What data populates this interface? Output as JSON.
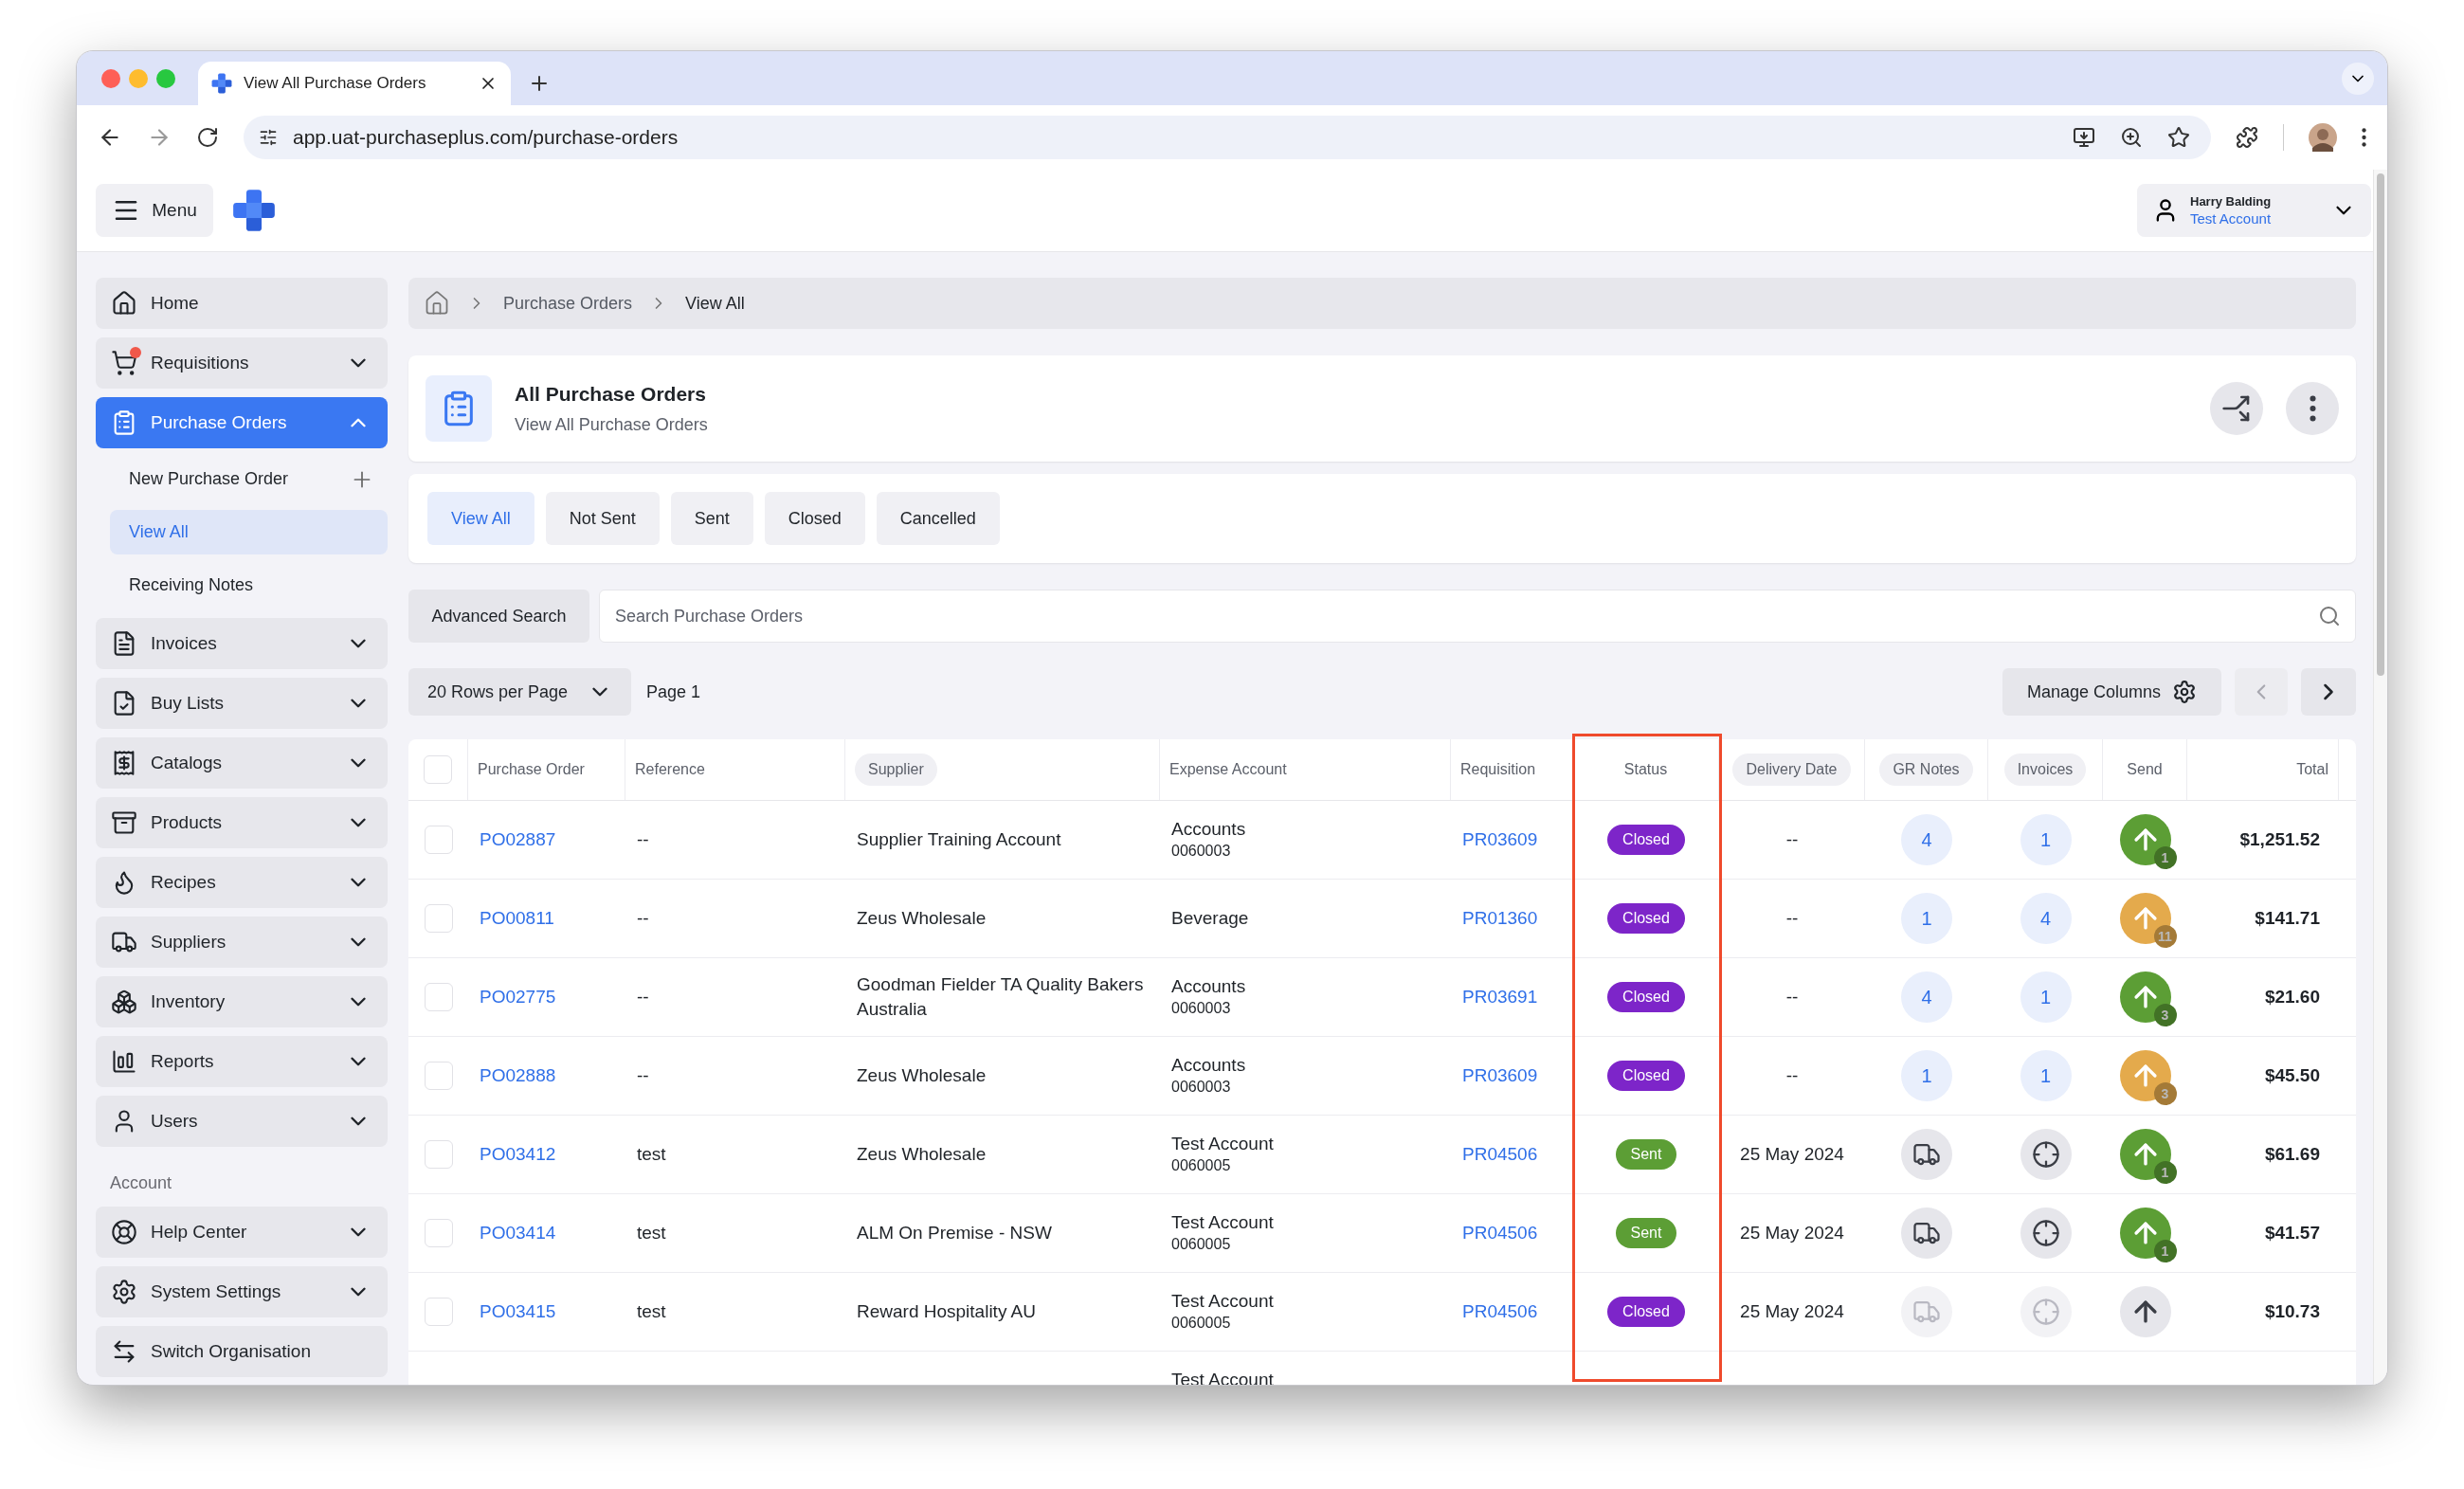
{
  "browser": {
    "tab_title": "View All Purchase Orders",
    "url": "app.uat-purchaseplus.com/purchase-orders"
  },
  "header": {
    "menu_label": "Menu",
    "user_name": "Harry Balding",
    "user_account": "Test Account"
  },
  "sidebar": {
    "items": [
      {
        "label": "Home",
        "kind": "link",
        "notification": false,
        "selected": false
      },
      {
        "label": "Requisitions",
        "kind": "group",
        "expanded": false,
        "notification": true,
        "selected": false
      },
      {
        "label": "Purchase Orders",
        "kind": "group",
        "expanded": true,
        "notification": false,
        "selected": true,
        "children": [
          {
            "label": "New Purchase Order",
            "kind": "action",
            "selected": false
          },
          {
            "label": "View All",
            "kind": "link",
            "selected": true
          },
          {
            "label": "Receiving Notes",
            "kind": "link",
            "selected": false
          }
        ]
      },
      {
        "label": "Invoices",
        "kind": "group",
        "expanded": false,
        "notification": false,
        "selected": false
      },
      {
        "label": "Buy Lists",
        "kind": "group",
        "expanded": false,
        "notification": false,
        "selected": false
      },
      {
        "label": "Catalogs",
        "kind": "group",
        "expanded": false,
        "notification": false,
        "selected": false
      },
      {
        "label": "Products",
        "kind": "group",
        "expanded": false,
        "notification": false,
        "selected": false
      },
      {
        "label": "Recipes",
        "kind": "group",
        "expanded": false,
        "notification": false,
        "selected": false
      },
      {
        "label": "Suppliers",
        "kind": "group",
        "expanded": false,
        "notification": false,
        "selected": false
      },
      {
        "label": "Inventory",
        "kind": "group",
        "expanded": false,
        "notification": false,
        "selected": false
      },
      {
        "label": "Reports",
        "kind": "group",
        "expanded": false,
        "notification": false,
        "selected": false
      },
      {
        "label": "Users",
        "kind": "group",
        "expanded": false,
        "notification": false,
        "selected": false
      }
    ],
    "section_label": "Account",
    "account_items": [
      {
        "label": "Help Center",
        "kind": "group",
        "expanded": false
      },
      {
        "label": "System Settings",
        "kind": "group",
        "expanded": false
      },
      {
        "label": "Switch Organisation",
        "kind": "link"
      }
    ]
  },
  "breadcrumb": [
    "Purchase Orders",
    "View All"
  ],
  "page": {
    "title": "All Purchase Orders",
    "subtitle": "View All Purchase Orders"
  },
  "filter_tabs": [
    {
      "label": "View All",
      "selected": true
    },
    {
      "label": "Not Sent",
      "selected": false
    },
    {
      "label": "Sent",
      "selected": false
    },
    {
      "label": "Closed",
      "selected": false
    },
    {
      "label": "Cancelled",
      "selected": false
    }
  ],
  "search": {
    "button": "Advanced Search",
    "placeholder": "Search Purchase Orders"
  },
  "pager": {
    "rows_per_page": "20 Rows per Page",
    "page": "Page 1",
    "manage_columns": "Manage Columns",
    "prev_disabled": true,
    "next_disabled": false
  },
  "table": {
    "select_all": {
      "checked": false
    },
    "columns": [
      {
        "label": "Purchase Order",
        "sortable": false,
        "highlighted": false
      },
      {
        "label": "Reference",
        "sortable": false,
        "highlighted": false
      },
      {
        "label": "Supplier",
        "sortable": true,
        "highlighted": false
      },
      {
        "label": "Expense Account",
        "sortable": false,
        "highlighted": false
      },
      {
        "label": "Requisition",
        "sortable": false,
        "highlighted": false
      },
      {
        "label": "Status",
        "sortable": false,
        "highlighted": true
      },
      {
        "label": "Delivery Date",
        "sortable": true,
        "highlighted": false
      },
      {
        "label": "GR Notes",
        "sortable": true,
        "highlighted": false
      },
      {
        "label": "Invoices",
        "sortable": true,
        "highlighted": false
      },
      {
        "label": "Send",
        "sortable": false,
        "highlighted": false
      },
      {
        "label": "Total",
        "sortable": false,
        "highlighted": false
      }
    ],
    "rows": [
      {
        "kind": "full",
        "checked": false,
        "purchase_order": "PO02887",
        "reference": "--",
        "supplier": "Supplier Training Account",
        "expense_account": "Accounts",
        "expense_code": "0060003",
        "requisition": "PR03609",
        "status": {
          "text": "Closed",
          "kind": "closed"
        },
        "delivery_date": "--",
        "gr_notes": {
          "kind": "count",
          "text": "4"
        },
        "invoices": {
          "kind": "count",
          "text": "1"
        },
        "send": {
          "color": "#5c9e35",
          "active": true,
          "count": "1"
        },
        "total": "$1,251.52"
      },
      {
        "kind": "full",
        "checked": false,
        "purchase_order": "PO00811",
        "reference": "--",
        "supplier": "Zeus Wholesale",
        "expense_account": "Beverage",
        "requisition": "PR01360",
        "status": {
          "text": "Closed",
          "kind": "closed"
        },
        "delivery_date": "--",
        "gr_notes": {
          "kind": "count",
          "text": "1"
        },
        "invoices": {
          "kind": "count",
          "text": "4"
        },
        "send": {
          "color": "#e4aa4c",
          "active": true,
          "count": "11"
        },
        "total": "$141.71"
      },
      {
        "kind": "full",
        "checked": false,
        "purchase_order": "PO02775",
        "reference": "--",
        "supplier": "Goodman Fielder TA Quality Bakers Australia",
        "expense_account": "Accounts",
        "expense_code": "0060003",
        "requisition": "PR03691",
        "status": {
          "text": "Closed",
          "kind": "closed"
        },
        "delivery_date": "--",
        "gr_notes": {
          "kind": "count",
          "text": "4"
        },
        "invoices": {
          "kind": "count",
          "text": "1"
        },
        "send": {
          "color": "#5c9e35",
          "active": true,
          "count": "3"
        },
        "total": "$21.60"
      },
      {
        "kind": "full",
        "checked": false,
        "purchase_order": "PO02888",
        "reference": "--",
        "supplier": "Zeus Wholesale",
        "expense_account": "Accounts",
        "expense_code": "0060003",
        "requisition": "PR03609",
        "status": {
          "text": "Closed",
          "kind": "closed"
        },
        "delivery_date": "--",
        "gr_notes": {
          "kind": "count",
          "text": "1"
        },
        "invoices": {
          "kind": "count",
          "text": "1"
        },
        "send": {
          "color": "#e4aa4c",
          "active": true,
          "count": "3"
        },
        "total": "$45.50"
      },
      {
        "kind": "full",
        "checked": false,
        "purchase_order": "PO03412",
        "reference": "test",
        "supplier": "Zeus Wholesale",
        "expense_account": "Test Account",
        "expense_code": "0060005",
        "requisition": "PR04506",
        "status": {
          "text": "Sent",
          "kind": "sent"
        },
        "delivery_date": "25 May 2024",
        "gr_notes": {
          "kind": "icon",
          "disabled": false
        },
        "invoices": {
          "kind": "icon",
          "disabled": false
        },
        "send": {
          "color": "#5c9e35",
          "active": true,
          "count": "1"
        },
        "total": "$61.69"
      },
      {
        "kind": "full",
        "checked": false,
        "purchase_order": "PO03414",
        "reference": "test",
        "supplier": "ALM On Premise - NSW",
        "expense_account": "Test Account",
        "expense_code": "0060005",
        "requisition": "PR04506",
        "status": {
          "text": "Sent",
          "kind": "sent"
        },
        "delivery_date": "25 May 2024",
        "gr_notes": {
          "kind": "icon",
          "disabled": false
        },
        "invoices": {
          "kind": "icon",
          "disabled": false
        },
        "send": {
          "color": "#5c9e35",
          "active": true,
          "count": "1"
        },
        "total": "$41.57"
      },
      {
        "kind": "full",
        "checked": false,
        "purchase_order": "PO03415",
        "reference": "test",
        "supplier": "Reward Hospitality AU",
        "expense_account": "Test Account",
        "expense_code": "0060005",
        "requisition": "PR04506",
        "status": {
          "text": "Closed",
          "kind": "closed"
        },
        "delivery_date": "25 May 2024",
        "gr_notes": {
          "kind": "icon",
          "disabled": true
        },
        "invoices": {
          "kind": "icon",
          "disabled": true
        },
        "send": {
          "color": "#e6e6eb",
          "active": false
        },
        "total": "$10.73"
      },
      {
        "kind": "partial",
        "expense_account": "Test Account"
      }
    ]
  }
}
